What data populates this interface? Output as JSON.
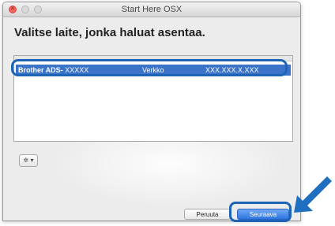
{
  "window": {
    "title": "Start Here OSX",
    "close_glyph": "×",
    "buttons": [
      "close",
      "minimize",
      "zoom"
    ]
  },
  "heading": "Valitse laite, jonka haluat asentaa.",
  "device_list": {
    "rows": [
      {
        "name": "Brother ADS-",
        "model": "XXXXX",
        "connection": "Verkko",
        "address": "XXX.XXX.X.XXX",
        "selected": true
      }
    ]
  },
  "gear_menu": {
    "icon": "gear-icon",
    "glyph": "✲ ▾"
  },
  "buttons": {
    "cancel": "Peruuta",
    "next": "Seuraava"
  },
  "colors": {
    "selection": "#3b73c9",
    "highlight_outline": "#1d64b6",
    "primary_button": "#2f76e0",
    "pointer_arrow": "#1f6fc0"
  },
  "annotation_arrow": {
    "icon": "pointer-arrow-icon",
    "points_to": "next-button"
  }
}
